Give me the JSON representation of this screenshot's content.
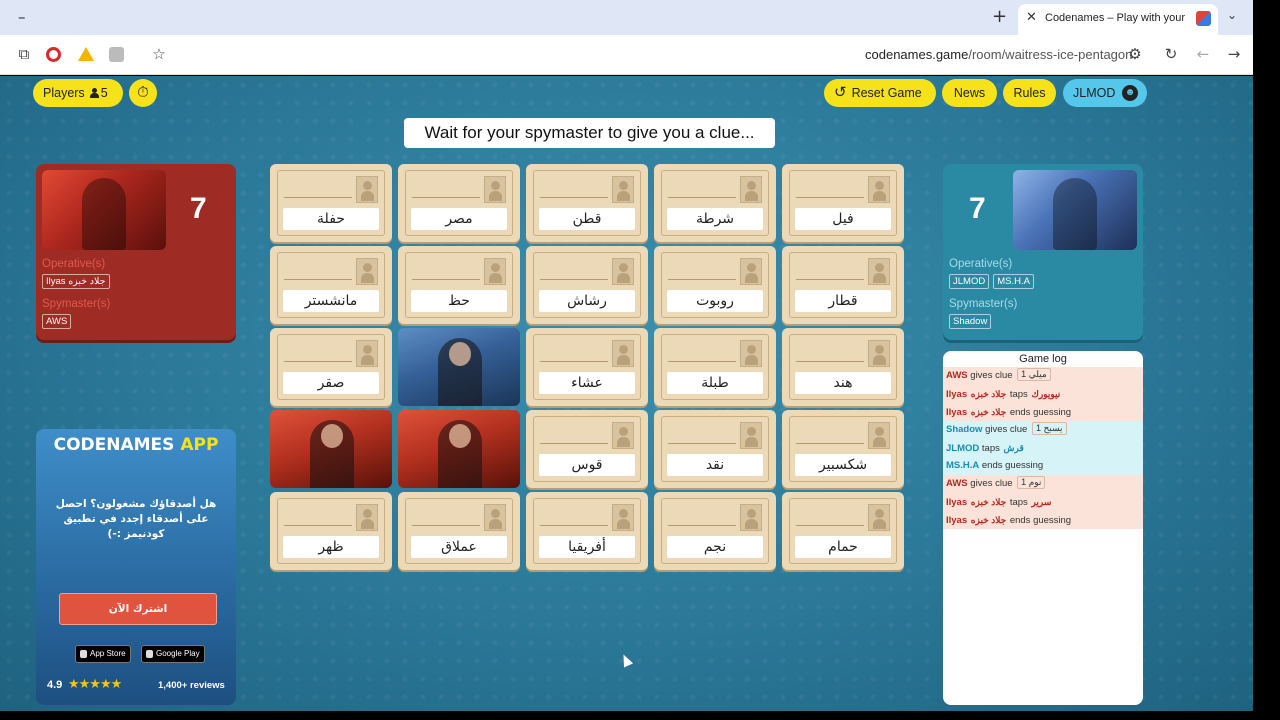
{
  "browser": {
    "tab_title": "Codenames – Play with your Fr",
    "url_host": "codenames.game",
    "url_path": "/room/waitress-ice-pentagon"
  },
  "toolbar": {
    "players_label": "Players",
    "players_count": "5",
    "reset_label": "Reset Game",
    "news_label": "News",
    "rules_label": "Rules",
    "user_label": "JLMOD"
  },
  "status": "Wait for your spymaster to give you a clue...",
  "red_team": {
    "count": "7",
    "operatives_label": "Operative(s)",
    "operatives": [
      "Ilyas",
      "جلاد خبزه"
    ],
    "spymaster_label": "Spymaster(s)",
    "spymasters": [
      "AWS"
    ]
  },
  "blue_team": {
    "count": "7",
    "operatives_label": "Operative(s)",
    "operatives": [
      "JLMOD",
      "MS.H.A"
    ],
    "spymaster_label": "Spymaster(s)",
    "spymasters": [
      "Shadow"
    ]
  },
  "board": {
    "words": [
      "حفلة",
      "مصر",
      "قطن",
      "شرطة",
      "فيل",
      "مانشستر",
      "حظ",
      "رشاش",
      "روبوت",
      "قطار",
      "صقر",
      "",
      "عشاء",
      "طبلة",
      "هند",
      "",
      "",
      "قوس",
      "نقد",
      "شكسبير",
      "ظهر",
      "عملاق",
      "أفريقيا",
      "نجم",
      "حمام"
    ],
    "revealed": [
      "",
      "",
      "",
      "",
      "",
      "",
      "",
      "",
      "",
      "",
      "",
      "blue",
      "",
      "",
      "",
      "red",
      "red",
      "",
      "",
      "",
      "",
      "",
      "",
      "",
      ""
    ]
  },
  "ad": {
    "title_main": "CODENAMES",
    "title_app": "APP",
    "text": "هل أصدقاؤك مشغولون؟ احصل على أصدقاء إجدد في تطبيق كودنيمز :-)",
    "cta": "اشترك الآن",
    "apple_label": "App Store",
    "google_label": "Google Play",
    "rating": "4.9",
    "stars": "★★★★★",
    "reviews": "1,400+ reviews"
  },
  "log": {
    "title": "Game log",
    "entries": [
      {
        "team": "red",
        "who": "AWS",
        "action": "gives clue",
        "clue": "ميلي 1"
      },
      {
        "team": "red",
        "who": "Ilyas",
        "extra": "جلاد خبزه",
        "action": "taps",
        "word": "نيويورك"
      },
      {
        "team": "red",
        "who": "Ilyas",
        "extra": "جلاد خبزه",
        "action": "ends guessing"
      },
      {
        "team": "blue",
        "who": "Shadow",
        "action": "gives clue",
        "clue": "يسبح 1"
      },
      {
        "team": "blue",
        "who": "JLMOD",
        "action": "taps",
        "word": "قرش"
      },
      {
        "team": "blue",
        "who": "MS.H.A",
        "action": "ends guessing"
      },
      {
        "team": "red",
        "who": "AWS",
        "action": "gives clue",
        "clue": "نوم 1"
      },
      {
        "team": "red",
        "who": "Ilyas",
        "extra": "جلاد خبزه",
        "action": "taps",
        "word": "سرير"
      },
      {
        "team": "red",
        "who": "Ilyas",
        "extra": "جلاد خبزه",
        "action": "ends guessing"
      }
    ]
  },
  "icons": {
    "timer": "stopwatch-icon",
    "reset": "reset-icon",
    "user": "smiley-icon"
  }
}
